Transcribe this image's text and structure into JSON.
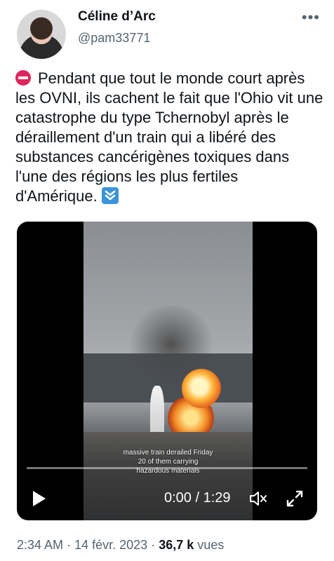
{
  "author": {
    "name": "Céline d’Arc",
    "handle": "@pam33771"
  },
  "tweet": {
    "text": "Pendant que tout le monde court après les OVNI, ils cachent le fait que l'Ohio vit une catastrophe du type Tchernobyl après le déraillement d'un train qui a libéré des substances cancérigènes toxiques dans l'une des régions les plus fertiles d'Amérique.",
    "leading_icon": "stop-sign-icon",
    "trailing_icon": "down-arrow-icon"
  },
  "video": {
    "caption_line1": "massive train derailed Friday",
    "caption_line2": "20 of them carrying",
    "caption_line3": "hazardous materials",
    "time": "0:00 / 1:29",
    "progress": 0.0
  },
  "footer": {
    "time": "2:34 AM",
    "sep1": "·",
    "date": "14 févr. 2023",
    "sep2": "·",
    "views_count": "36,7 k",
    "views_label": "vues"
  },
  "colors": {
    "text": "#0f1419",
    "muted": "#536471",
    "stop_icon": "#e0245e",
    "arrow_icon": "#3b94d9"
  }
}
